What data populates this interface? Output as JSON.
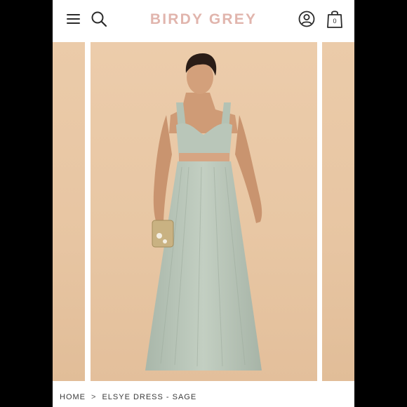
{
  "header": {
    "logo_text": "BIRDY GREY",
    "menu_icon": "hamburger-menu-icon",
    "search_icon": "search-icon",
    "account_icon": "account-icon",
    "bag_icon": "shopping-bag-icon",
    "bag_count": "0"
  },
  "colors": {
    "logo": "#e1b5ad",
    "background": "#e8c7a4",
    "dress": "#b6c3b6"
  },
  "breadcrumb": {
    "home": "HOME",
    "separator": ">",
    "current": "ELSYE DRESS - SAGE"
  }
}
